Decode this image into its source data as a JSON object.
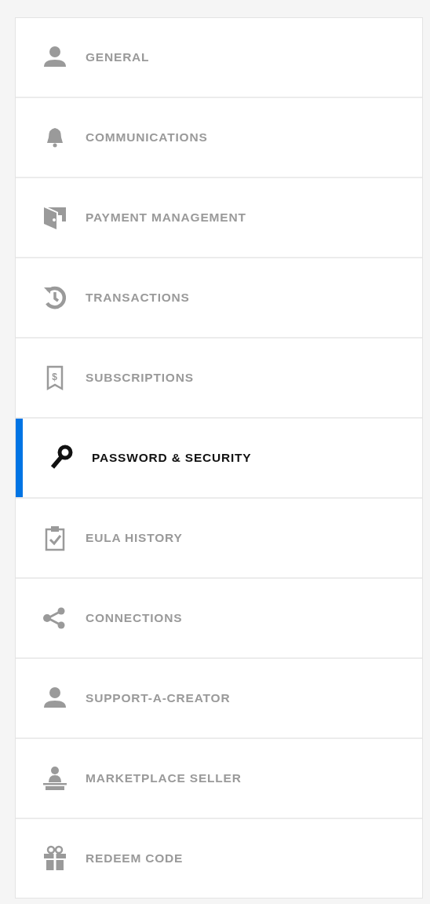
{
  "menu": {
    "items": [
      {
        "label": "GENERAL",
        "selected": false
      },
      {
        "label": "COMMUNICATIONS",
        "selected": false
      },
      {
        "label": "PAYMENT MANAGEMENT",
        "selected": false
      },
      {
        "label": "TRANSACTIONS",
        "selected": false
      },
      {
        "label": "SUBSCRIPTIONS",
        "icon_text": "$",
        "selected": false
      },
      {
        "label": "PASSWORD & SECURITY",
        "selected": true
      },
      {
        "label": "EULA HISTORY",
        "selected": false
      },
      {
        "label": "CONNECTIONS",
        "selected": false
      },
      {
        "label": "SUPPORT-A-CREATOR",
        "selected": false
      },
      {
        "label": "MARKETPLACE SELLER",
        "selected": false
      },
      {
        "label": "REDEEM CODE",
        "selected": false
      }
    ]
  }
}
